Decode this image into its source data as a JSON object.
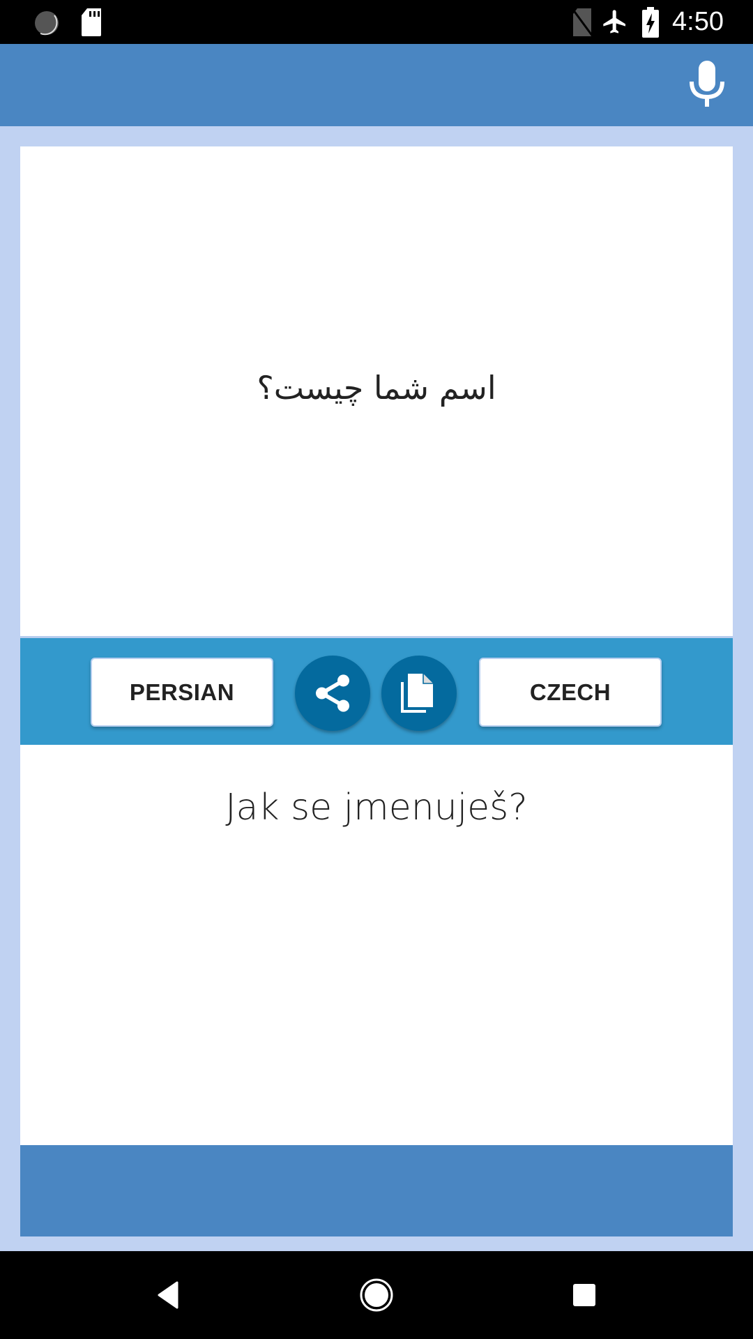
{
  "status_bar": {
    "time": "4:50",
    "icons": [
      "sync-icon",
      "sd-card-icon",
      "no-sim-icon",
      "airplane-mode-icon",
      "battery-charging-icon"
    ]
  },
  "app_bar": {
    "mic_button": "microphone-icon"
  },
  "source": {
    "text": "اسم شما چیست؟"
  },
  "toolbar": {
    "source_language": "PERSIAN",
    "target_language": "CZECH",
    "share_button": "share-icon",
    "copy_button": "copy-icon"
  },
  "target": {
    "text": "Jak se jmenuješ?"
  },
  "nav_bar": {
    "buttons": [
      "back",
      "home",
      "recents"
    ]
  },
  "colors": {
    "app_bar": "#4a86c2",
    "background": "#c0d2f2",
    "toolbar": "#3399cc",
    "circle_button": "#046a9e"
  }
}
